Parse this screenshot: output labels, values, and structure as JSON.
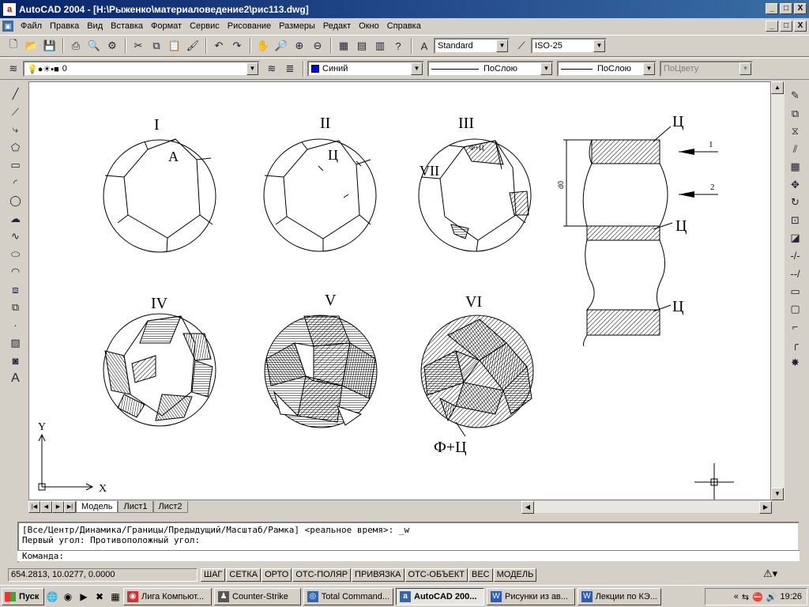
{
  "window": {
    "title": "AutoCAD 2004 - [H:\\Рыженко\\материаловедение2\\рис113.dwg]",
    "minimize": "_",
    "maximize": "□",
    "close": "X"
  },
  "menu": [
    "Файл",
    "Правка",
    "Вид",
    "Вставка",
    "Формат",
    "Сервис",
    "Рисование",
    "Размеры",
    "Редакт",
    "Окно",
    "Справка"
  ],
  "toolbar1": {
    "textstyle": "Standard",
    "dimstyle": "ISO-25"
  },
  "toolbar2": {
    "layer": "0",
    "color": "Синий",
    "linetype": "ПоСлою",
    "lineweight": "ПоСлою",
    "plotstyle": "ПоЦвету"
  },
  "drawing": {
    "labels": {
      "I": "I",
      "II": "II",
      "III": "III",
      "IV": "IV",
      "V": "V",
      "VI": "VI",
      "VII": "VII"
    },
    "texts": {
      "a": "A",
      "c": "Ц",
      "fc_small": "Ф+Ц",
      "fc": "Ф+Ц",
      "d0": "d0",
      "arrow1": "1",
      "arrow2": "2"
    }
  },
  "ucs": {
    "x": "X",
    "y": "Y"
  },
  "tabs": {
    "model": "Модель",
    "sheet1": "Лист1",
    "sheet2": "Лист2"
  },
  "command": {
    "line1": "[Все/Центр/Динамика/Границы/Предыдущий/Масштаб/Рамка] <реальное время>: _w",
    "line2": "Первый угол: Противоположный угол:",
    "prompt": "Команда:"
  },
  "status": {
    "coords": "654.2813, 10.0277, 0.0000",
    "buttons": [
      "ШАГ",
      "СЕТКА",
      "ОРТО",
      "ОТС-ПОЛЯР",
      "ПРИВЯЗКА",
      "ОТС-ОБЪЕКТ",
      "ВЕС",
      "МОДЕЛЬ"
    ]
  },
  "taskbar": {
    "start": "Пуск",
    "tasks": [
      "Лига Компьют...",
      "Counter-Strike",
      "Total Command...",
      "AutoCAD 200...",
      "Рисунки из ав...",
      "Лекции по КЭ..."
    ],
    "clock": "19:26"
  },
  "colors": {
    "title_start": "#0a246a",
    "title_end": "#3a6ea5",
    "canvas": "#ffffff",
    "layer_color": "#0000ff"
  }
}
